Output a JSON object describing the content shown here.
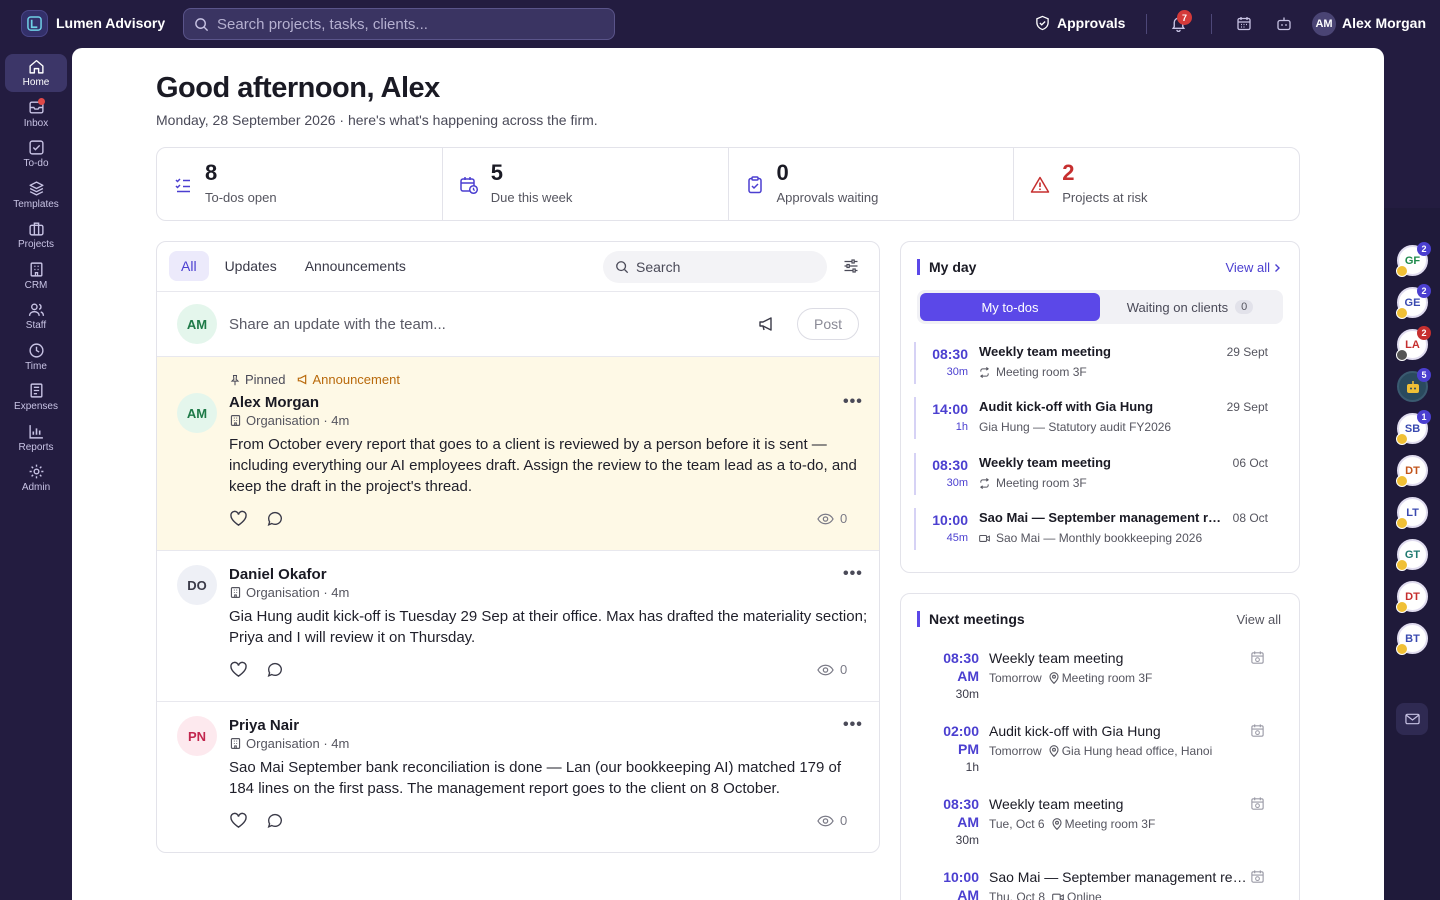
{
  "app": {
    "name": "Lumen Advisory"
  },
  "search": {
    "placeholder": "Search projects, tasks, clients..."
  },
  "topbar": {
    "approvals_label": "Approvals",
    "notification_count": "7",
    "user_initials": "AM",
    "user_name": "Alex Morgan"
  },
  "nav": [
    {
      "label": "Home",
      "icon": "home-icon",
      "active": true
    },
    {
      "label": "Inbox",
      "icon": "inbox-icon",
      "dot": true
    },
    {
      "label": "To-do",
      "icon": "todo-icon"
    },
    {
      "label": "Templates",
      "icon": "layers-icon"
    },
    {
      "label": "Projects",
      "icon": "briefcase-icon"
    },
    {
      "label": "CRM",
      "icon": "building-icon"
    },
    {
      "label": "Staff",
      "icon": "users-icon"
    },
    {
      "label": "Time",
      "icon": "clock-icon"
    },
    {
      "label": "Expenses",
      "icon": "receipt-icon"
    },
    {
      "label": "Reports",
      "icon": "bar-chart-icon"
    },
    {
      "label": "Admin",
      "icon": "gear-icon"
    }
  ],
  "header": {
    "greeting": "Good afternoon, Alex",
    "subtitle": "Monday, 28 September 2026 · here's what's happening across the firm."
  },
  "stats": [
    {
      "value": "8",
      "label": "To-dos open",
      "color": "#1a1a24",
      "icon": "checklist-icon"
    },
    {
      "value": "5",
      "label": "Due this week",
      "color": "#1a1a24",
      "icon": "calendar-clock-icon"
    },
    {
      "value": "0",
      "label": "Approvals waiting",
      "color": "#1a1a24",
      "icon": "clipboard-check-icon"
    },
    {
      "value": "2",
      "label": "Projects at risk",
      "color": "#c62f2f",
      "icon": "warning-icon"
    }
  ],
  "feed": {
    "tabs": [
      "All",
      "Updates",
      "Announcements"
    ],
    "search_label": "Search",
    "composer": {
      "initials": "AM",
      "placeholder": "Share an update with the team...",
      "post_label": "Post"
    },
    "pinned_label": "Pinned",
    "announcement_label": "Announcement",
    "posts": [
      {
        "initials": "AM",
        "author": "Alex Morgan",
        "meta": "Organisation · 4m",
        "body": "From October every report that goes to a client is reviewed by a person before it is sent — including everything our AI employees draft. Assign the review to the team lead as a to-do, and keep the draft in the project's thread.",
        "views": "0",
        "pinned": true
      },
      {
        "initials": "DO",
        "author": "Daniel Okafor",
        "meta": "Organisation · 4m",
        "body": "Gia Hung audit kick-off is Tuesday 29 Sep at their office. Max has drafted the materiality section; Priya and I will review it on Thursday.",
        "views": "0"
      },
      {
        "initials": "PN",
        "author": "Priya Nair",
        "meta": "Organisation · 4m",
        "body": "Sao Mai September bank reconciliation is done — Lan (our bookkeeping AI) matched 179 of 184 lines on the first pass. The management report goes to the client on 8 October.",
        "views": "0"
      }
    ]
  },
  "my_day": {
    "title": "My day",
    "view_all": "View all",
    "tabs": [
      {
        "label": "My to-dos"
      },
      {
        "label": "Waiting on clients",
        "count": "0"
      }
    ],
    "items": [
      {
        "time": "08:30",
        "duration": "30m",
        "title": "Weekly team meeting",
        "date": "29 Sept",
        "sub": "Meeting room 3F",
        "sub_icon": "repeat-icon"
      },
      {
        "time": "14:00",
        "duration": "1h",
        "title": "Audit kick-off with Gia Hung",
        "date": "29 Sept",
        "sub": "Gia Hung — Statutory audit FY2026",
        "sub_icon": ""
      },
      {
        "time": "08:30",
        "duration": "30m",
        "title": "Weekly team meeting",
        "date": "06 Oct",
        "sub": "Meeting room 3F",
        "sub_icon": "repeat-icon"
      },
      {
        "time": "10:00",
        "duration": "45m",
        "title": "Sao Mai — September management rep...",
        "date": "08 Oct",
        "sub": "Sao Mai — Monthly bookkeeping 2026",
        "sub_icon": "video-icon"
      }
    ]
  },
  "next_meetings": {
    "title": "Next meetings",
    "view_all": "View all",
    "items": [
      {
        "time": "08:30",
        "ampm": "AM",
        "duration": "30m",
        "title": "Weekly team meeting",
        "when": "Tomorrow",
        "where": "Meeting room 3F",
        "where_icon": "pin-icon"
      },
      {
        "time": "02:00",
        "ampm": "PM",
        "duration": "1h",
        "title": "Audit kick-off with Gia Hung",
        "when": "Tomorrow",
        "where": "Gia Hung head office, Hanoi",
        "where_icon": "pin-icon"
      },
      {
        "time": "08:30",
        "ampm": "AM",
        "duration": "30m",
        "title": "Weekly team meeting",
        "when": "Tue, Oct 6",
        "where": "Meeting room 3F",
        "where_icon": "pin-icon"
      },
      {
        "time": "10:00",
        "ampm": "AM",
        "duration": "",
        "title": "Sao Mai — September management rep...",
        "when": "Thu, Oct 8",
        "where": "Online",
        "where_icon": "video-icon"
      }
    ]
  },
  "rail": [
    {
      "initials": "GF",
      "color": "#1f8a4c",
      "badge": "2",
      "badge_color": "#4b3fd0"
    },
    {
      "initials": "GE",
      "color": "#3a4ab0",
      "badge": "2",
      "badge_color": "#4b3fd0"
    },
    {
      "initials": "LA",
      "color": "#c62f2f",
      "badge": "2",
      "badge_color": "#c62f2f"
    },
    {
      "initials": "",
      "color": "#1f8a4c",
      "badge": "5",
      "badge_color": "#4b3fd0",
      "icon": true
    },
    {
      "initials": "SB",
      "color": "#3a4ab0",
      "badge": "1",
      "badge_color": "#4b3fd0"
    },
    {
      "initials": "DT",
      "color": "#c2541a",
      "badge": ""
    },
    {
      "initials": "LT",
      "color": "#3a4ab0",
      "badge": ""
    },
    {
      "initials": "GT",
      "color": "#1f7a70",
      "badge": ""
    },
    {
      "initials": "DT",
      "color": "#c62f2f",
      "badge": ""
    },
    {
      "initials": "BT",
      "color": "#3a4ab0",
      "badge": ""
    }
  ]
}
